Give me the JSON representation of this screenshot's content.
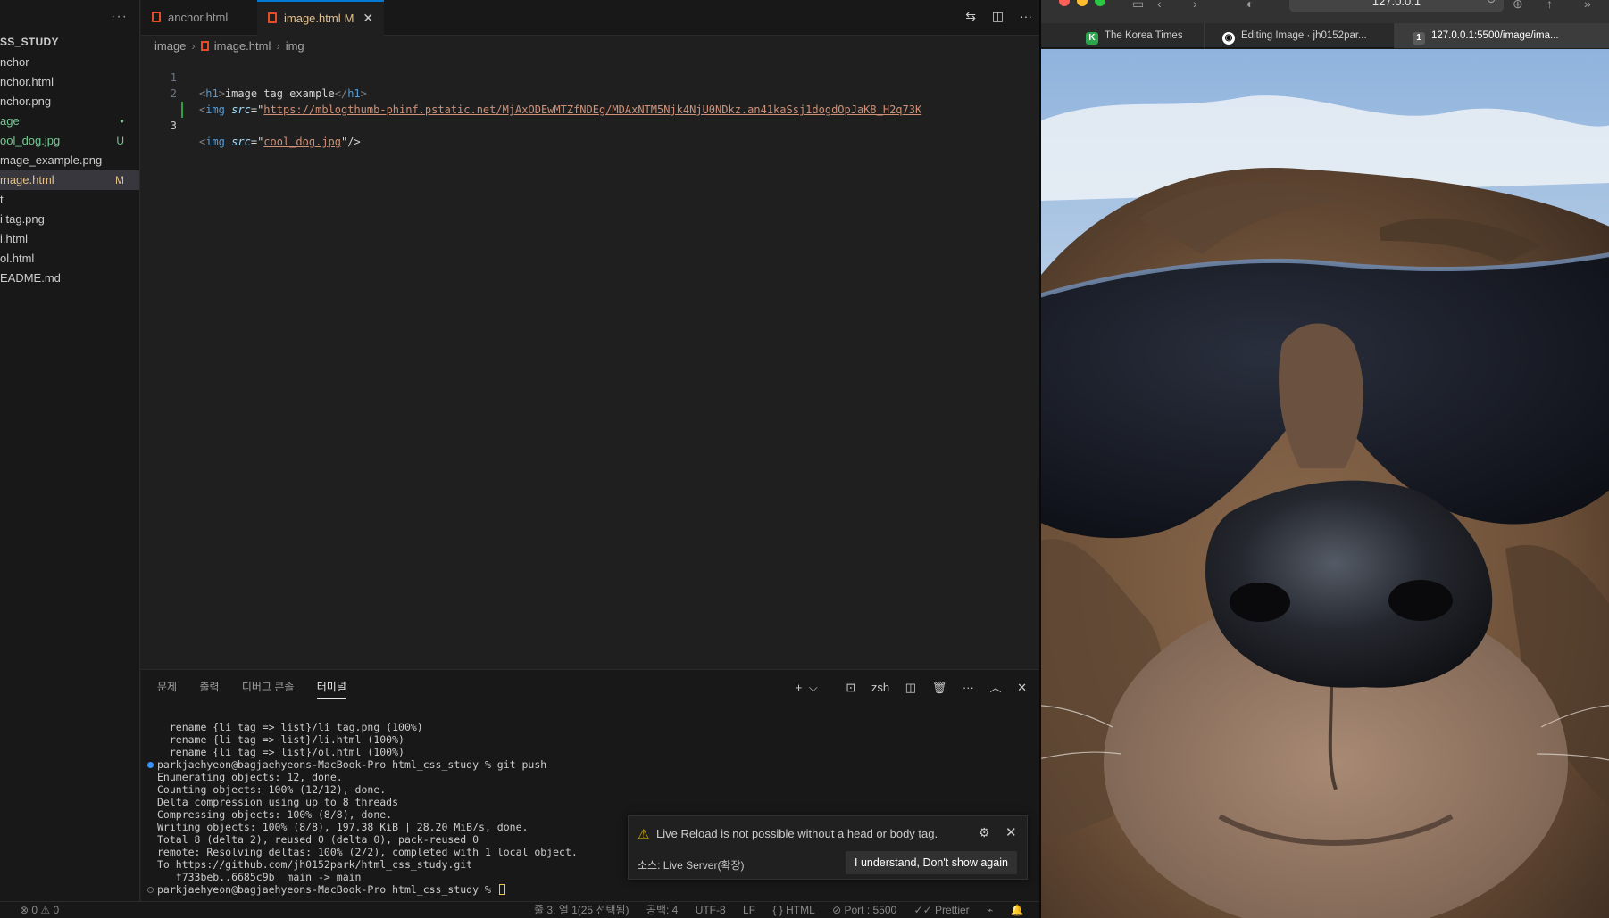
{
  "explorer": {
    "more_label": "···",
    "root_label": "SS_STUDY",
    "items": [
      {
        "label": "nchor",
        "badge": "",
        "color": "#cccccc"
      },
      {
        "label": "nchor.html",
        "badge": "",
        "color": "#cccccc"
      },
      {
        "label": "nchor.png",
        "badge": "",
        "color": "#cccccc"
      },
      {
        "label": "age",
        "badge": "●",
        "color": "#73c991"
      },
      {
        "label": "ool_dog.jpg",
        "badge": "U",
        "color": "#73c991"
      },
      {
        "label": "mage_example.png",
        "badge": "",
        "color": "#cccccc"
      },
      {
        "label": "mage.html",
        "badge": "M",
        "color": "#e2c08d"
      },
      {
        "label": "t",
        "badge": "",
        "color": "#cccccc"
      },
      {
        "label": "i tag.png",
        "badge": "",
        "color": "#cccccc"
      },
      {
        "label": "i.html",
        "badge": "",
        "color": "#cccccc"
      },
      {
        "label": "ol.html",
        "badge": "",
        "color": "#cccccc"
      },
      {
        "label": "EADME.md",
        "badge": "",
        "color": "#cccccc"
      }
    ]
  },
  "tabs": [
    {
      "label": "anchor.html",
      "modified": "",
      "close": ""
    },
    {
      "label": "image.html",
      "modified": "M",
      "close": "✕"
    }
  ],
  "editor_actions": [
    "⇆",
    "◫",
    "···"
  ],
  "breadcrumb": {
    "folder": "image",
    "file": "image.html",
    "symbol": "img"
  },
  "code": {
    "lines": [
      {
        "num": "1",
        "open": "<",
        "tag": "h1",
        "close": ">",
        "text": "image tag example",
        "end_open": "</",
        "end_tag": "h1",
        "end_close": ">"
      },
      {
        "num": "2",
        "open": "<",
        "tag": "img",
        "attr": "src",
        "eq": "=\"",
        "value": "https://mblogthumb-phinf.pstatic.net/MjAxODEwMTZfNDEg/MDAxNTM5Njk4NjU0NDkz.an41kaSsj1dogdOpJaK8_H2q73K",
        "q": ""
      },
      {
        "num": "3",
        "open": "<",
        "tag": "img",
        "attr": "src",
        "eq": "=\"",
        "value": "cool_dog.jpg",
        "q": "\"/>"
      }
    ]
  },
  "panel": {
    "tabs": [
      "문제",
      "출력",
      "디버그 콘솔",
      "터미널"
    ],
    "actions": {
      "add": "+",
      "chevron": "⌵",
      "shell": "zsh",
      "split": "◫",
      "trash": "🗑",
      "more": "···",
      "maximize": "︿",
      "close": "✕"
    },
    "terminal": [
      {
        "text": "  rename {li tag => list}/li tag.png (100%)",
        "dot": ""
      },
      {
        "text": "  rename {li tag => list}/li.html (100%)",
        "dot": ""
      },
      {
        "text": "  rename {li tag => list}/ol.html (100%)",
        "dot": ""
      },
      {
        "text": "parkjaehyeon@bagjaehyeons-MacBook-Pro html_css_study % git push",
        "dot": "#3794ff"
      },
      {
        "text": "Enumerating objects: 12, done.",
        "dot": ""
      },
      {
        "text": "Counting objects: 100% (12/12), done.",
        "dot": ""
      },
      {
        "text": "Delta compression using up to 8 threads",
        "dot": ""
      },
      {
        "text": "Compressing objects: 100% (8/8), done.",
        "dot": ""
      },
      {
        "text": "Writing objects: 100% (8/8), 197.38 KiB | 28.20 MiB/s, done.",
        "dot": ""
      },
      {
        "text": "Total 8 (delta 2), reused 0 (delta 0), pack-reused 0",
        "dot": ""
      },
      {
        "text": "remote: Resolving deltas: 100% (2/2), completed with 1 local object.",
        "dot": ""
      },
      {
        "text": "To https://github.com/jh0152park/html_css_study.git",
        "dot": ""
      },
      {
        "text": "   f733beb..6685c9b  main -> main",
        "dot": ""
      },
      {
        "text": "parkjaehyeon@bagjaehyeons-MacBook-Pro html_css_study % ",
        "dot": "#6e6e6e"
      }
    ]
  },
  "notification": {
    "warn_icon": "⚠",
    "message": "Live Reload is not possible without a head or body tag.",
    "gear_icon": "⚙",
    "close_icon": "✕",
    "source": "소스: Live Server(확장)",
    "button": "I understand, Don't show again"
  },
  "statusbar": {
    "problems": "⊗ 0 ⚠ 0",
    "cursor_pos": "줄 3, 열 1(25 선택됨)",
    "spaces": "공백: 4",
    "encoding": "UTF-8",
    "eol": "LF",
    "language": "{ } HTML",
    "port": "⊘ Port : 5500",
    "prettier": "✓✓ Prettier",
    "accounts": "⌁",
    "bell": "🔔"
  },
  "browser": {
    "address": "127.0.0.1",
    "tabs": [
      {
        "fav": "K",
        "fav_bg": "#2ea44f",
        "label": "The Korea Times"
      },
      {
        "fav": "◉",
        "fav_bg": "#ffffff",
        "label": "Editing Image · jh0152par..."
      },
      {
        "fav": "1",
        "fav_bg": "#5a5a5a",
        "label": "127.0.0.1:5500/image/ima..."
      }
    ]
  }
}
